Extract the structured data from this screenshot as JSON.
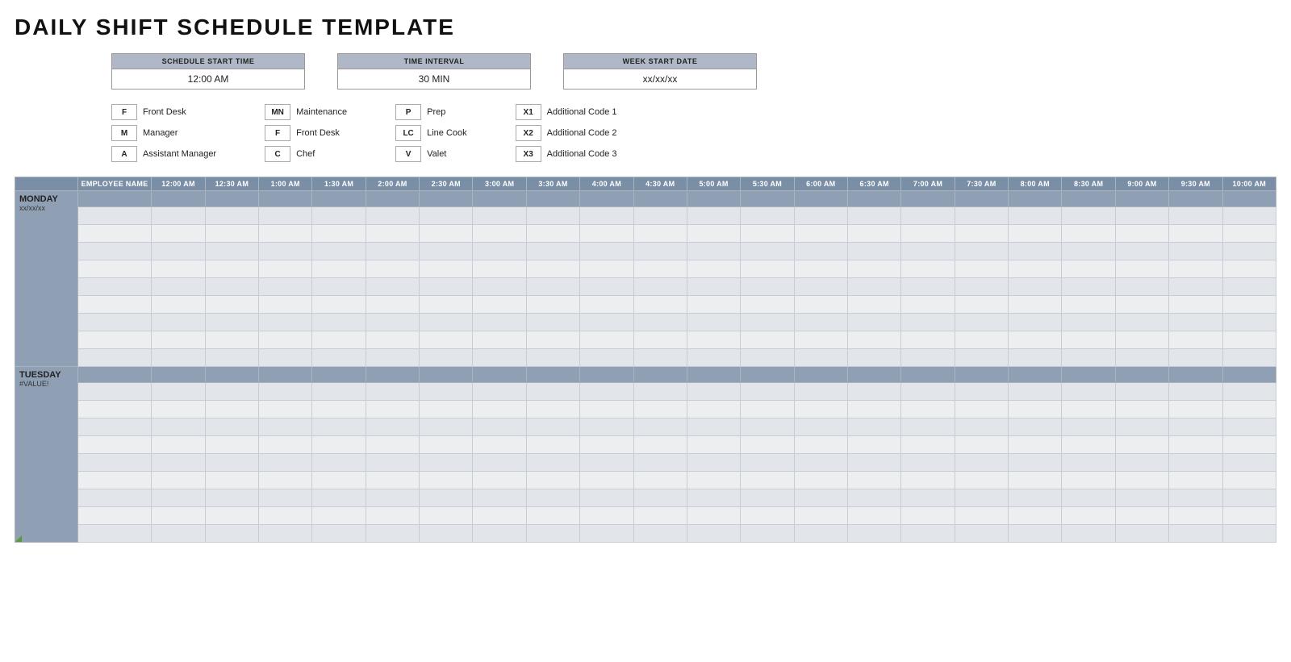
{
  "title": "DAILY SHIFT SCHEDULE TEMPLATE",
  "controls": {
    "schedule_start_time_label": "SCHEDULE START TIME",
    "schedule_start_time_value": "12:00 AM",
    "time_interval_label": "TIME INTERVAL",
    "time_interval_value": "30 MIN",
    "week_start_date_label": "WEEK START DATE",
    "week_start_date_value": "xx/xx/xx"
  },
  "legend": [
    [
      {
        "code": "F",
        "desc": "Front Desk"
      },
      {
        "code": "M",
        "desc": "Manager"
      },
      {
        "code": "A",
        "desc": "Assistant Manager"
      }
    ],
    [
      {
        "code": "MN",
        "desc": "Maintenance"
      },
      {
        "code": "F",
        "desc": "Front Desk"
      },
      {
        "code": "C",
        "desc": "Chef"
      }
    ],
    [
      {
        "code": "P",
        "desc": "Prep"
      },
      {
        "code": "LC",
        "desc": "Line Cook"
      },
      {
        "code": "V",
        "desc": "Valet"
      }
    ],
    [
      {
        "code": "X1",
        "desc": "Additional Code 1"
      },
      {
        "code": "X2",
        "desc": "Additional Code 2"
      },
      {
        "code": "X3",
        "desc": "Additional Code 3"
      }
    ]
  ],
  "table": {
    "emp_header": "EMPLOYEE NAME",
    "time_columns": [
      "12:00 AM",
      "12:30 AM",
      "1:00 AM",
      "1:30 AM",
      "2:00 AM",
      "2:30 AM",
      "3:00 AM",
      "3:30 AM",
      "4:00 AM",
      "4:30 AM",
      "5:00 AM",
      "5:30 AM",
      "6:00 AM",
      "6:30 AM",
      "7:00 AM",
      "7:30 AM",
      "8:00 AM",
      "8:30 AM",
      "9:00 AM",
      "9:30 AM",
      "10:00 AM"
    ],
    "days": [
      {
        "name": "MONDAY",
        "date": "xx/xx/xx",
        "rows": 9
      },
      {
        "name": "TUESDAY",
        "date": "#VALUE!",
        "rows": 9,
        "has_green_corner": true
      }
    ]
  }
}
